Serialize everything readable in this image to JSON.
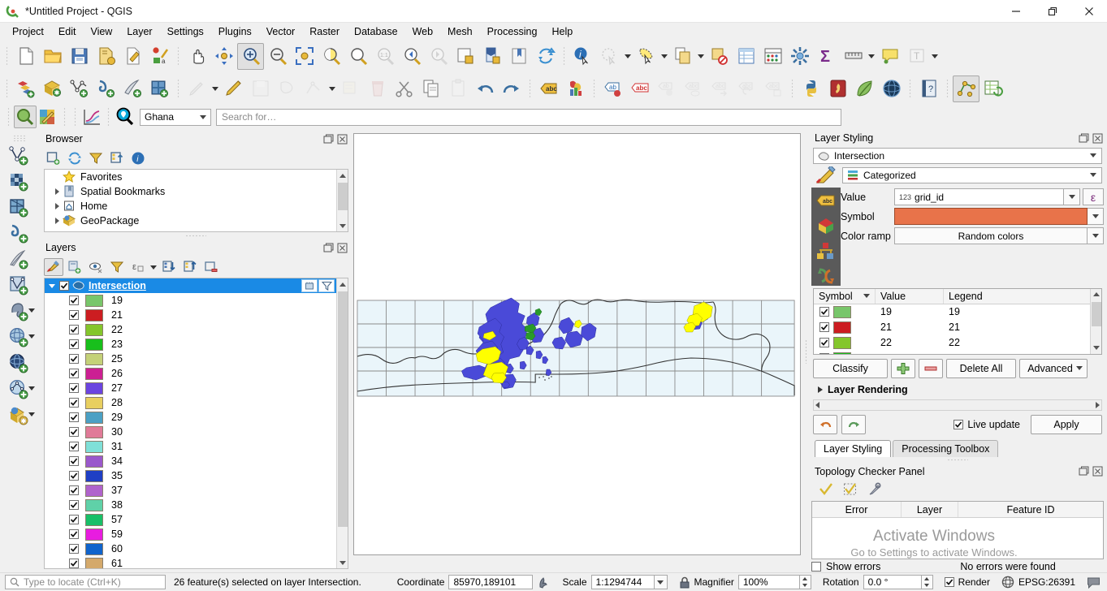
{
  "window": {
    "title": "*Untitled Project - QGIS",
    "minimize": "—",
    "maximize": "❐",
    "close": "✕"
  },
  "menubar": {
    "items": [
      {
        "label": "Project"
      },
      {
        "label": "Edit"
      },
      {
        "label": "View"
      },
      {
        "label": "Layer"
      },
      {
        "label": "Settings"
      },
      {
        "label": "Plugins"
      },
      {
        "label": "Vector"
      },
      {
        "label": "Raster"
      },
      {
        "label": "Database"
      },
      {
        "label": "Web"
      },
      {
        "label": "Mesh"
      },
      {
        "label": "Processing"
      },
      {
        "label": "Help"
      }
    ]
  },
  "search": {
    "scope_value": "Ghana",
    "placeholder": "Search for…"
  },
  "browser": {
    "title": "Browser",
    "toolbar": [
      "add-layer-icon",
      "refresh-icon",
      "filter-icon",
      "collapse-all-icon",
      "properties-icon"
    ],
    "items": [
      {
        "label": "Favorites",
        "icon": "star-icon",
        "expandable": false
      },
      {
        "label": "Spatial Bookmarks",
        "icon": "bookmark-icon",
        "expandable": true
      },
      {
        "label": "Home",
        "icon": "home-icon",
        "expandable": true
      },
      {
        "label": "GeoPackage",
        "icon": "geopackage-icon",
        "expandable": true
      }
    ]
  },
  "layers": {
    "title": "Layers",
    "root": {
      "name": "Intersection",
      "checked": true
    },
    "categories": [
      {
        "value": "19",
        "color": "#78c66a"
      },
      {
        "value": "21",
        "color": "#cc1d21"
      },
      {
        "value": "22",
        "color": "#84c62b"
      },
      {
        "value": "23",
        "color": "#18bf1c"
      },
      {
        "value": "25",
        "color": "#c4d178"
      },
      {
        "value": "26",
        "color": "#cc1f93"
      },
      {
        "value": "27",
        "color": "#6b44e0"
      },
      {
        "value": "28",
        "color": "#e8cf5f"
      },
      {
        "value": "29",
        "color": "#4ba0c4"
      },
      {
        "value": "30",
        "color": "#e07a98"
      },
      {
        "value": "31",
        "color": "#7fe0d8"
      },
      {
        "value": "34",
        "color": "#9a58cc"
      },
      {
        "value": "35",
        "color": "#1f3fc4"
      },
      {
        "value": "37",
        "color": "#b063cc"
      },
      {
        "value": "38",
        "color": "#5fd1a8"
      },
      {
        "value": "57",
        "color": "#18bf68"
      },
      {
        "value": "59",
        "color": "#e81ce0"
      },
      {
        "value": "60",
        "color": "#1064cc"
      },
      {
        "value": "61",
        "color": "#d4a96b"
      }
    ]
  },
  "layer_styling": {
    "title": "Layer Styling",
    "layer_combo": "Intersection",
    "renderer_combo": "Categorized",
    "value_label": "Value",
    "value_field": "grid_id",
    "value_field_prefix": "123",
    "symbol_label": "Symbol",
    "symbol_color": "#e8734a",
    "color_ramp_label": "Color ramp",
    "color_ramp_value": "Random colors",
    "table_headers": [
      "Symbol",
      "Value",
      "Legend"
    ],
    "table_rows": [
      {
        "checked": true,
        "color": "#78c66a",
        "value": "19",
        "legend": "19"
      },
      {
        "checked": true,
        "color": "#cc1d21",
        "value": "21",
        "legend": "21"
      },
      {
        "checked": true,
        "color": "#84c62b",
        "value": "22",
        "legend": "22"
      },
      {
        "checked": true,
        "color": "#18bf1c",
        "value": "23",
        "legend": "23"
      }
    ],
    "buttons": {
      "classify": "Classify",
      "add": "+",
      "remove": "−",
      "delete_all": "Delete All",
      "advanced": "Advanced"
    },
    "layer_rendering": "Layer Rendering",
    "live_update": "Live update",
    "live_update_checked": true,
    "apply": "Apply"
  },
  "panel_tabs": [
    {
      "label": "Layer Styling",
      "selected": true
    },
    {
      "label": "Processing Toolbox",
      "selected": false
    }
  ],
  "topology": {
    "title": "Topology Checker Panel",
    "headers": [
      "Error",
      "Layer",
      "Feature ID"
    ],
    "show_errors": "Show errors",
    "show_errors_checked": false,
    "status": "No errors were found"
  },
  "watermark": {
    "line1": "Activate Windows",
    "line2": "Go to Settings to activate Windows."
  },
  "statusbar": {
    "locate_placeholder": "Type to locate (Ctrl+K)",
    "message": "26 feature(s) selected on layer Intersection.",
    "coordinate_label": "Coordinate",
    "coordinate_value": "85970,189101",
    "scale_label": "Scale",
    "scale_value": "1:1294744",
    "magnifier_label": "Magnifier",
    "magnifier_value": "100%",
    "rotation_label": "Rotation",
    "rotation_value": "0.0 °",
    "render_label": "Render",
    "render_checked": true,
    "crs_value": "EPSG:26391"
  },
  "map": {
    "grid_color": "#8a8a8a",
    "cell_fill": "#eaf5fa",
    "selection_color": "#ffff00",
    "feature_color": "#4a4ad8",
    "outline_color": "#333333"
  }
}
